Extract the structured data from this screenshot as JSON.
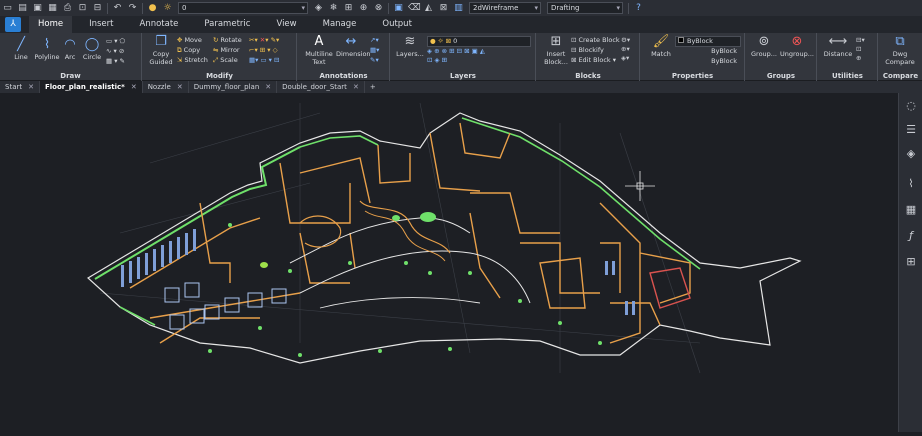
{
  "qat": {
    "layer_value": "0",
    "visualstyle_value": "2dWireframe",
    "workspace_value": "Drafting"
  },
  "tabs": [
    "Home",
    "Insert",
    "Annotate",
    "Parametric",
    "View",
    "Manage",
    "Output"
  ],
  "ribbon": {
    "draw": {
      "title": "Draw",
      "line": "Line",
      "polyline": "Polyline",
      "arc": "Arc",
      "circle": "Circle"
    },
    "modify": {
      "title": "Modify",
      "move": "Move",
      "copy": "Copy",
      "stretch": "Stretch",
      "rotate": "Rotate",
      "mirror": "Mirror",
      "scale": "Scale",
      "copy_guided": "Copy Guided"
    },
    "annotations": {
      "title": "Annotations",
      "mtext": "Multiline Text",
      "dimension": "Dimension"
    },
    "layers": {
      "title": "Layers",
      "layers_btn": "Layers...",
      "layer_value": "0"
    },
    "blocks": {
      "title": "Blocks",
      "insert": "Insert Block...",
      "create": "Create Block",
      "blockify": "Blockify",
      "edit": "Edit Block"
    },
    "properties": {
      "title": "Properties",
      "match": "Match",
      "color": "ByBlock",
      "linetype": "ByBlock",
      "lineweight": "ByBlock"
    },
    "groups": {
      "title": "Groups",
      "group": "Group...",
      "ungroup": "Ungroup..."
    },
    "utilities": {
      "title": "Utilities",
      "distance": "Distance"
    },
    "compare": {
      "title": "Compare",
      "dwg_compare": "Dwg Compare"
    }
  },
  "doc_tabs": [
    "Start",
    "Floor_plan_realistic*",
    "Nozzle",
    "Dummy_floor_plan",
    "Double_door_Start"
  ],
  "active_doc": "Floor_plan_realistic*",
  "colors": {
    "accent": "#2a7fd4",
    "wall_orange": "#e8a04a",
    "wall_green": "#6fe06a",
    "wall_white": "#e6e6e6",
    "furniture_blue": "#7f9fd8"
  }
}
